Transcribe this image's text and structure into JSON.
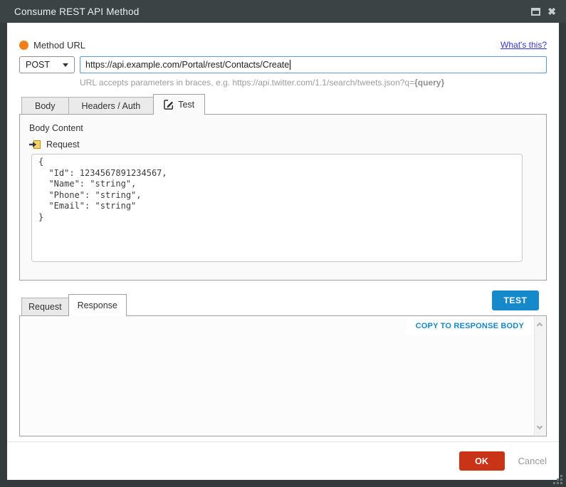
{
  "window": {
    "title": "Consume REST API Method"
  },
  "method": {
    "label": "Method URL",
    "help_link": "What's this?",
    "verb": "POST",
    "url": "https://api.example.com/Portal/rest/Contacts/Create",
    "hint_text": "URL accepts parameters in braces, e.g. https://api.twitter.com/1.1/search/tweets.json?q=",
    "hint_bold": "{query}"
  },
  "tabs": {
    "body": "Body",
    "headers_auth": "Headers / Auth",
    "test": "Test"
  },
  "test_panel": {
    "section_label": "Body Content",
    "request_label": "Request",
    "request_body": "{\n  \"Id\": 1234567891234567,\n  \"Name\": \"string\",\n  \"Phone\": \"string\",\n  \"Email\": \"string\"\n}"
  },
  "result": {
    "request_tab": "Request",
    "response_tab": "Response",
    "test_button": "TEST",
    "copy_button": "COPY TO RESPONSE BODY",
    "response_body": ""
  },
  "footer": {
    "ok": "OK",
    "cancel": "Cancel"
  },
  "colors": {
    "titlebar": "#3b4345",
    "accent_blue": "#1689cb",
    "copy_link_blue": "#1787c9",
    "ok_red": "#c93318",
    "help_link_blue": "#3434d6",
    "param_orange": "#f0801a",
    "url_focus_border": "#5a97d5"
  }
}
